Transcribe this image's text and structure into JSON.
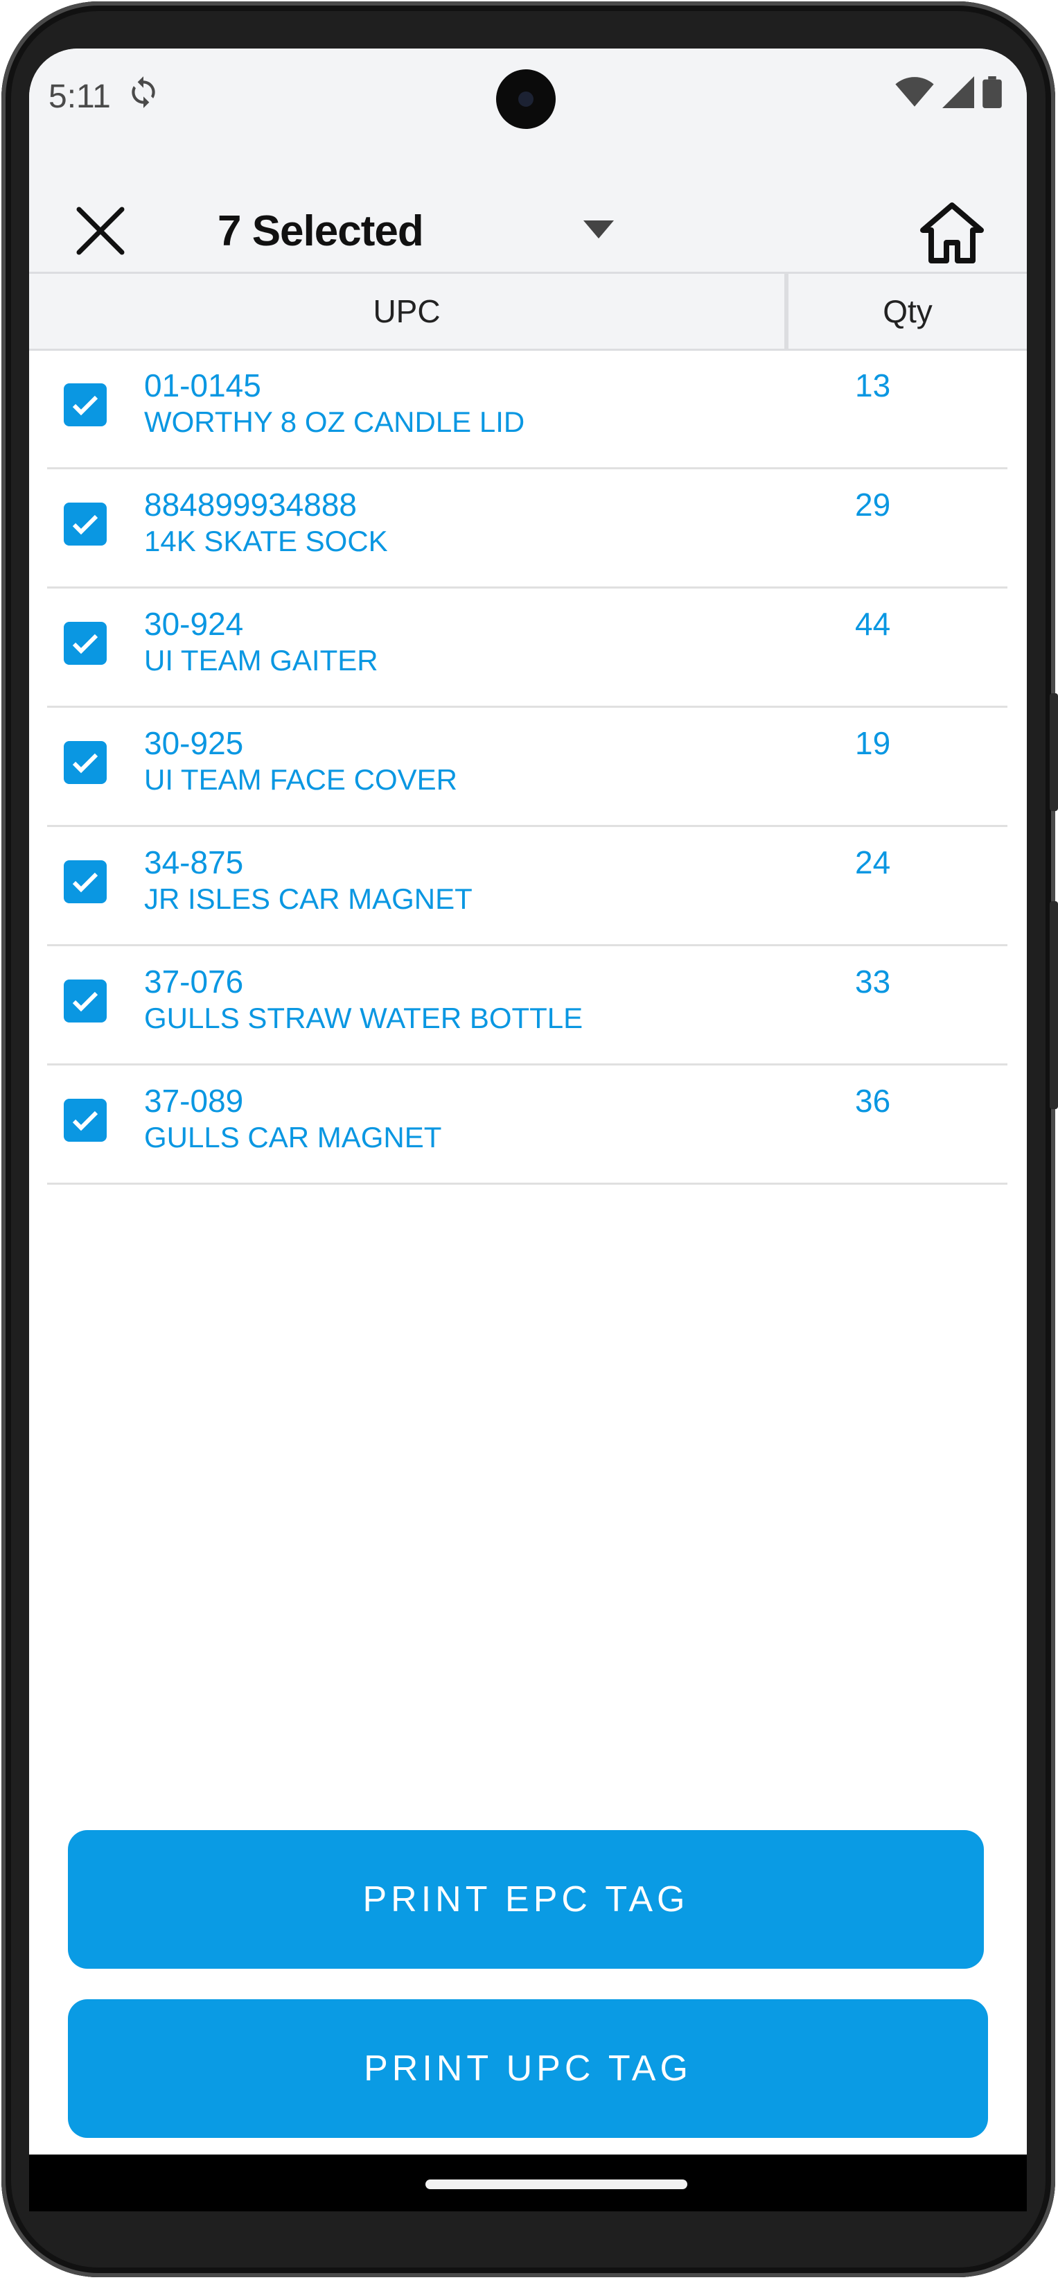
{
  "status_bar": {
    "time": "5:11"
  },
  "app_bar": {
    "title": "7 Selected"
  },
  "table": {
    "headers": {
      "upc": "UPC",
      "qty": "Qty"
    },
    "rows": [
      {
        "upc": "01-0145",
        "description": "WORTHY 8 OZ CANDLE LID",
        "qty": "13",
        "checked": true
      },
      {
        "upc": "884899934888",
        "description": "14K SKATE SOCK",
        "qty": "29",
        "checked": true
      },
      {
        "upc": "30-924",
        "description": "UI TEAM GAITER",
        "qty": "44",
        "checked": true
      },
      {
        "upc": "30-925",
        "description": "UI TEAM FACE COVER",
        "qty": "19",
        "checked": true
      },
      {
        "upc": "34-875",
        "description": "JR ISLES CAR MAGNET",
        "qty": "24",
        "checked": true
      },
      {
        "upc": "37-076",
        "description": "GULLS STRAW WATER BOTTLE",
        "qty": "33",
        "checked": true
      },
      {
        "upc": "37-089",
        "description": "GULLS CAR MAGNET",
        "qty": "36",
        "checked": true
      }
    ]
  },
  "actions": {
    "print_epc": "PRINT EPC TAG",
    "print_upc": "PRINT UPC TAG"
  },
  "colors": {
    "accent": "#0a97e2",
    "button": "#0a9be4",
    "bar_background": "#f3f4f6"
  }
}
